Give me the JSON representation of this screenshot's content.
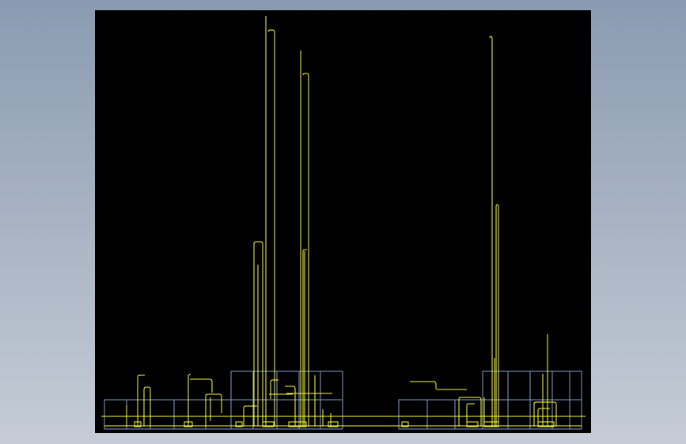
{
  "viewport": {
    "background_gradient": [
      "#8a9bb1",
      "#c5ccd6"
    ],
    "canvas_background": "#000000"
  },
  "drawing": {
    "frame_color": "#7f9fcf",
    "pipe_color": "#ffff33"
  }
}
